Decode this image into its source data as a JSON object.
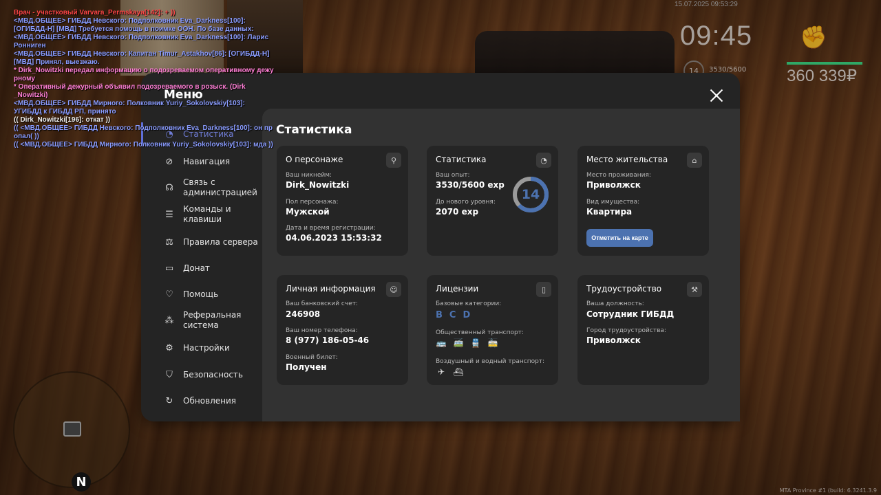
{
  "hud": {
    "date": "15.07.2025 09:53:29",
    "time": "09:45",
    "money": "360 339₽",
    "level": "14",
    "exp": "3530/5600",
    "build": "MTA Province #1 (build: 6.3241.3.9"
  },
  "chat": [
    {
      "text": "Врач - участковый Varvara_Permskaya[142]: + ))",
      "color": "red"
    },
    {
      "text": "<МВД.ОБЩЕЕ> ГИБДД Невского: Подполковник Eva_Darkness[100]:",
      "color": "blue"
    },
    {
      "text": "[ОГИБДД-Н] [МВД] Требуется помощь в поимке ООН. По базе данных:",
      "color": "blue"
    },
    {
      "text": "<МВД.ОБЩЕЕ> ГИБДД Невского: Подполковник Eva_Darkness[100]: Ларис",
      "color": "blue"
    },
    {
      "text": "Ронниген",
      "color": "blue"
    },
    {
      "text": "<МВД.ОБЩЕЕ> ГИБДД Невского: Капитан Timur_Astakhov[86]: [ОГИБДД-Н]",
      "color": "blue"
    },
    {
      "text": "[МВД] Принял, выезжаю.",
      "color": "blue"
    },
    {
      "text": "* Dirk_Nowitzki передал информацию о подозреваемом оперативному дежу",
      "color": "pink"
    },
    {
      "text": "рному",
      "color": "pink"
    },
    {
      "text": "* Оперативный дежурный объявил подозреваемого в розыск. (Dirk",
      "color": "pink"
    },
    {
      "text": "_Nowitzki)",
      "color": "pink"
    },
    {
      "text": "<МВД.ОБЩЕЕ> ГИБДД Мирного: Полковник Yuriy_Sokolovskiy[103]:",
      "color": "blue"
    },
    {
      "text": "УГИБДД к ГИБДД РП, принято",
      "color": "blue"
    },
    {
      "text": "(( Dirk_Nowitzki[196]: откат ))",
      "color": "white"
    },
    {
      "text": "(( <МВД.ОБЩЕЕ> ГИБДД Невского: Подполковник Eva_Darkness[100]: он пр",
      "color": "blue"
    },
    {
      "text": "опал( ))",
      "color": "blue"
    },
    {
      "text": "(( <МВД.ОБЩЕЕ> ГИБДД Мирного: Полковник Yuriy_Sokolovskiy[103]: мда ))",
      "color": "blue"
    }
  ],
  "menu": {
    "title": "Меню",
    "items": [
      {
        "label": "Статистика",
        "icon": "pie-chart-icon"
      },
      {
        "label": "Навигация",
        "icon": "compass-icon"
      },
      {
        "label": "Связь с администрацией",
        "icon": "headset-icon"
      },
      {
        "label": "Команды и клавиши",
        "icon": "document-icon"
      },
      {
        "label": "Правила сервера",
        "icon": "scales-icon"
      },
      {
        "label": "Донат",
        "icon": "wallet-icon"
      },
      {
        "label": "Помощь",
        "icon": "handshake-icon"
      },
      {
        "label": "Реферальная система",
        "icon": "network-icon"
      },
      {
        "label": "Настройки",
        "icon": "gear-icon"
      },
      {
        "label": "Безопасность",
        "icon": "shield-icon"
      },
      {
        "label": "Обновления",
        "icon": "refresh-icon"
      }
    ]
  },
  "content": {
    "title": "Статистика",
    "character": {
      "title": "О персонаже",
      "nickname_label": "Ваш никнейм:",
      "nickname": "Dirk_Nowitzki",
      "gender_label": "Пол персонажа:",
      "gender": "Мужской",
      "reg_label": "Дата и время регистрации:",
      "reg": "04.06.2023 15:53:32"
    },
    "stats": {
      "title": "Статистика",
      "exp_label": "Ваш опыт:",
      "exp": "3530/5600 exp",
      "next_label": "До нового уровня:",
      "next": "2070 exp",
      "level": "14",
      "progress": 0.63
    },
    "residence": {
      "title": "Место жительства",
      "place_label": "Место проживания:",
      "place": "Приволжск",
      "property_label": "Вид имущества:",
      "property": "Квартира",
      "button": "Отметить на карте"
    },
    "personal": {
      "title": "Личная информация",
      "bank_label": "Ваш банковский счет:",
      "bank": "246908",
      "phone_label": "Ваш номер телефона:",
      "phone": "8 (977) 186-05-46",
      "military_label": "Военный билет:",
      "military": "Получен"
    },
    "licenses": {
      "title": "Лицензии",
      "base_label": "Базовые категории:",
      "categories": [
        "B",
        "C",
        "D"
      ],
      "public_label": "Общественный транспорт:",
      "air_label": "Воздушный и водный транспорт:"
    },
    "employment": {
      "title": "Трудоустройство",
      "position_label": "Ваша должность:",
      "position": "Сотрудник ГИБДД",
      "city_label": "Город трудоустройства:",
      "city": "Приволжск"
    }
  },
  "colors": {
    "accent": "#4c72b0",
    "active_menu": "#6f7cd6",
    "hp": "#2fa866"
  }
}
